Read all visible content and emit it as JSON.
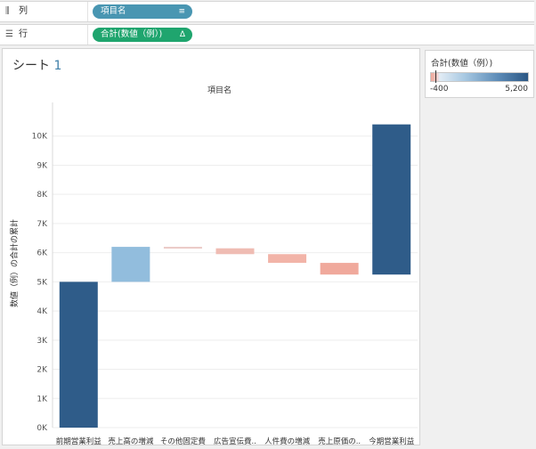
{
  "shelves": {
    "columns": {
      "label": "列",
      "icon": "columns-icon",
      "pill": "項目名"
    },
    "rows": {
      "label": "行",
      "icon": "rows-icon",
      "pill": "合計(数値（例）)",
      "pill_glyph": "Δ"
    }
  },
  "sheet": {
    "title_text": "シート",
    "title_num": "1",
    "x_header": "項目名"
  },
  "legend": {
    "title": "合計(数値（例）)",
    "min_label": "-400",
    "max_label": "5,200",
    "min_value": -400,
    "max_value": 5200
  },
  "chart_data": {
    "type": "waterfall",
    "ylabel": "数値（例）の合計の累計",
    "ylim": [
      0,
      11000
    ],
    "y_ticks": [
      0,
      1000,
      2000,
      3000,
      4000,
      5000,
      6000,
      7000,
      8000,
      9000,
      10000
    ],
    "y_tick_labels": [
      "0K",
      "1K",
      "2K",
      "3K",
      "4K",
      "5K",
      "6K",
      "7K",
      "8K",
      "9K",
      "10K"
    ],
    "grid": true,
    "bars": [
      {
        "category": "前期営業利益",
        "start": 0,
        "end": 5000,
        "value": 5000,
        "color": "#2f5c89"
      },
      {
        "category": "売上高の増減",
        "start": 5000,
        "end": 6200,
        "value": 1200,
        "color": "#92bddd"
      },
      {
        "category": "その他固定費",
        "start": 6200,
        "end": 6150,
        "value": -50,
        "color": "#ebcac6"
      },
      {
        "category": "広告宣伝費..",
        "start": 6150,
        "end": 5950,
        "value": -200,
        "color": "#efbcb3"
      },
      {
        "category": "人件費の増減",
        "start": 5950,
        "end": 5650,
        "value": -300,
        "color": "#f2b4a8"
      },
      {
        "category": "売上原価の..",
        "start": 5650,
        "end": 5250,
        "value": -400,
        "color": "#f0a99c"
      },
      {
        "category": "今期営業利益",
        "start": 5250,
        "end": 10400,
        "value": 5150,
        "color": "#2f5c89"
      }
    ]
  }
}
